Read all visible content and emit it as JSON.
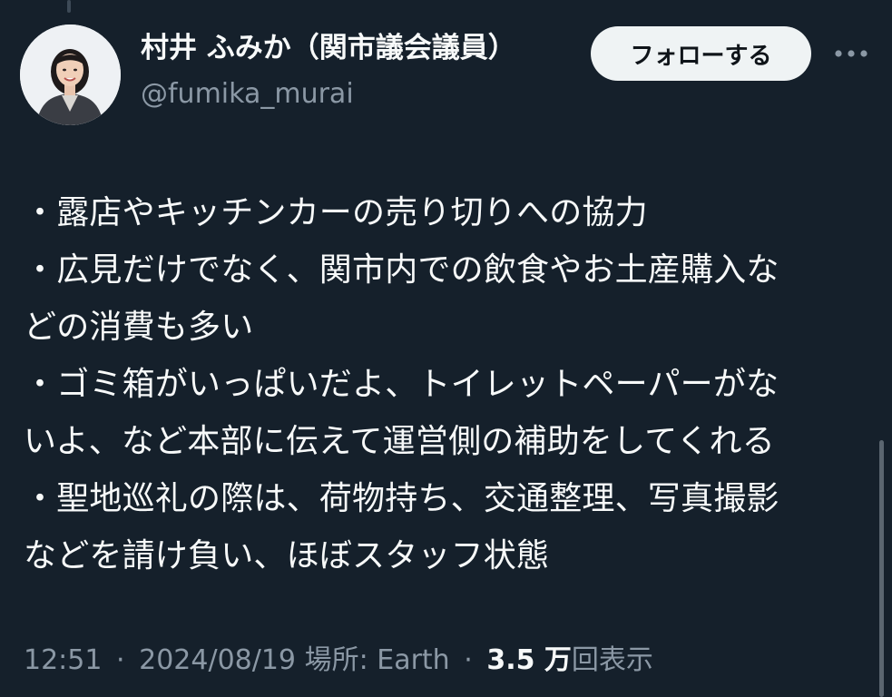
{
  "author": {
    "display_name": "村井 ふみか（関市議会議員）",
    "handle": "@fumika_murai",
    "avatar": "avatar-photo"
  },
  "follow_button": {
    "label": "フォローする"
  },
  "more_button": {
    "icon": "more-horizontal-icon"
  },
  "tweet": {
    "lines": [
      "・露店やキッチンカーの売り切りへの協力",
      "・広見だけでなく、関市内での飲食やお土産購入な",
      "どの消費も多い",
      "・ゴミ箱がいっぱいだよ、トイレットペーパーがな",
      "いよ、など本部に伝えて運営側の補助をしてくれる",
      "・聖地巡礼の際は、荷物持ち、交通整理、写真撮影",
      "などを請け負い、ほぼスタッフ状態"
    ]
  },
  "meta": {
    "time": "12:51",
    "separator": "·",
    "date": "2024/08/19",
    "location_label": "場所:",
    "location": "Earth",
    "views_count": "3.5 万",
    "views_label": "回表示"
  },
  "colors": {
    "background": "#15202b",
    "text_primary": "#f7f9f9",
    "text_secondary": "#8b98a5",
    "button_bg": "#eff3f4"
  }
}
